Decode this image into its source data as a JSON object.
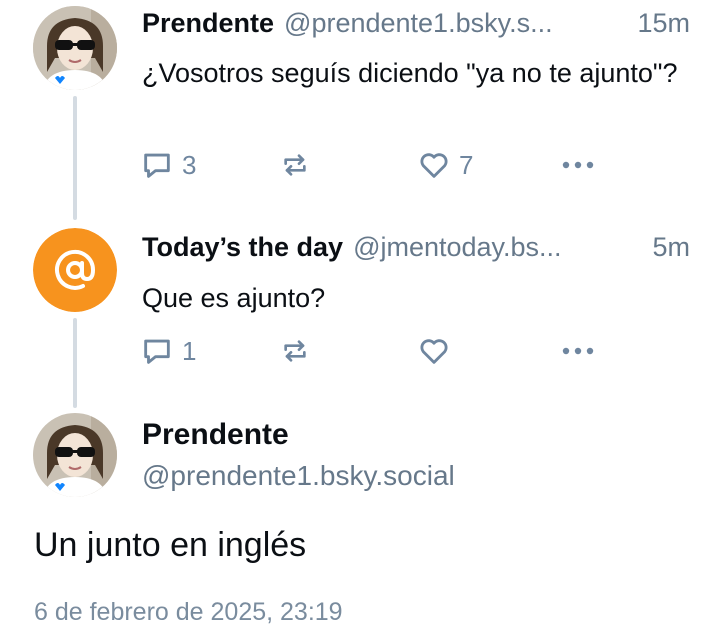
{
  "posts": [
    {
      "display_name": "Prendente",
      "handle": "@prendente1.bsky.s...",
      "time": "15m",
      "text": "¿Vosotros seguís diciendo \"ya no te ajunto\"?",
      "reply_count": "3",
      "repost_count": "",
      "like_count": "7",
      "avatar": "photo-sunglasses-butterfly"
    },
    {
      "display_name": "Today’s the day",
      "handle": "@jmentoday.bs...",
      "time": "5m",
      "text": "Que es ajunto?",
      "reply_count": "1",
      "repost_count": "",
      "like_count": "",
      "avatar": "at-sign-icon",
      "avatar_color": "#f7931e"
    }
  ],
  "main_post": {
    "display_name": "Prendente",
    "handle": "@prendente1.bsky.social",
    "text": "Un junto en inglés",
    "date": "6 de febrero de 2025, 23:19"
  },
  "icons": {
    "reply": "speech-bubble-icon",
    "repost": "repost-arrows-icon",
    "like": "heart-icon",
    "more": "ellipsis-icon"
  },
  "colors": {
    "text": "#0b0f14",
    "muted": "#66788a",
    "action": "#6f869f",
    "thread_line": "#d4dbe2",
    "accent_orange": "#f7931e",
    "butterfly_blue": "#1185fe"
  }
}
